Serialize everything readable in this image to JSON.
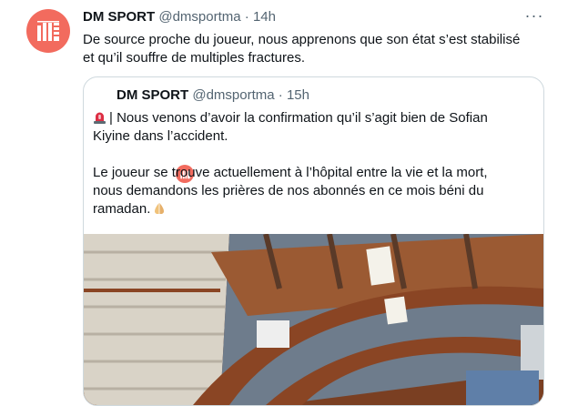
{
  "tweet": {
    "author_name": "DM SPORT",
    "author_handle": "@dmsportma",
    "separator": "·",
    "time": "14h",
    "more_label": "···",
    "text_line1": "De source proche du joueur, nous apprenons que son état s’est stabilisé",
    "text_line2": "et qu’il souffre de multiples fractures."
  },
  "quote": {
    "author_name": "DM SPORT",
    "author_handle": "@dmsportma",
    "separator": "·",
    "time": "15h",
    "para1": "| Nous venons d’avoir la confirmation qu’il s’agit bien de Sofian Kiyine dans l’accident.",
    "para2": "Le joueur se trouve actuellement à l’hôpital entre la vie et la mort, nous demandons les prières de nos abonnés en ce mois béni du ramadan.",
    "icons": {
      "siren": "rotating-light-emoji",
      "hands": "folded-hands-emoji"
    }
  },
  "colors": {
    "avatar_bg": "#f26b5e",
    "text": "#0f1419",
    "muted": "#536471",
    "border": "#cfd9de"
  }
}
